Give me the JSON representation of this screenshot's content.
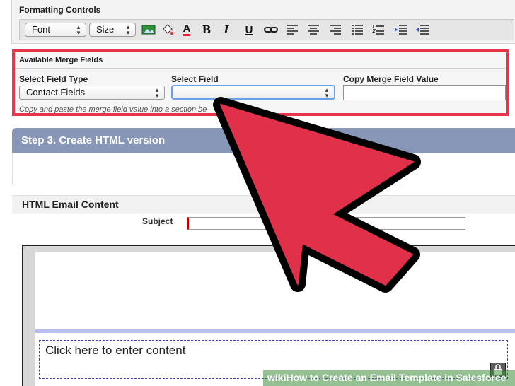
{
  "formatting": {
    "title": "Formatting Controls",
    "font_select": "Font",
    "size_select": "Size",
    "buttons": [
      {
        "name": "insert-image-icon"
      },
      {
        "name": "paint-bucket-icon"
      },
      {
        "name": "font-color-icon",
        "label": "A"
      },
      {
        "name": "bold-icon",
        "label": "B"
      },
      {
        "name": "italic-icon",
        "label": "I"
      },
      {
        "name": "underline-icon",
        "label": "U"
      },
      {
        "name": "link-icon"
      },
      {
        "name": "align-left-icon"
      },
      {
        "name": "align-center-icon"
      },
      {
        "name": "align-right-icon"
      },
      {
        "name": "bullet-list-icon"
      },
      {
        "name": "numbered-list-icon"
      },
      {
        "name": "indent-icon"
      },
      {
        "name": "outdent-icon"
      }
    ]
  },
  "merge": {
    "title": "Available Merge Fields",
    "field_type_label": "Select Field Type",
    "field_type_value": "Contact Fields",
    "select_field_label": "Select Field",
    "select_field_value": "",
    "copy_label": "Copy Merge Field Value",
    "copy_value": "",
    "help": "Copy and paste the merge field value into a section be",
    "highlight_color": "#e8354a"
  },
  "step3": {
    "title": "Step 3. Create HTML version"
  },
  "html_section": {
    "title": "HTML Email Content",
    "subject_label": "Subject",
    "subject_value": ""
  },
  "editor": {
    "content_placeholder": "Click here to enter content"
  },
  "watermark": {
    "text": "wikiHow to Create an Email Template in Salesforce"
  },
  "colors": {
    "arrow_fill": "#e0304a",
    "step_bar": "#8896b8"
  }
}
